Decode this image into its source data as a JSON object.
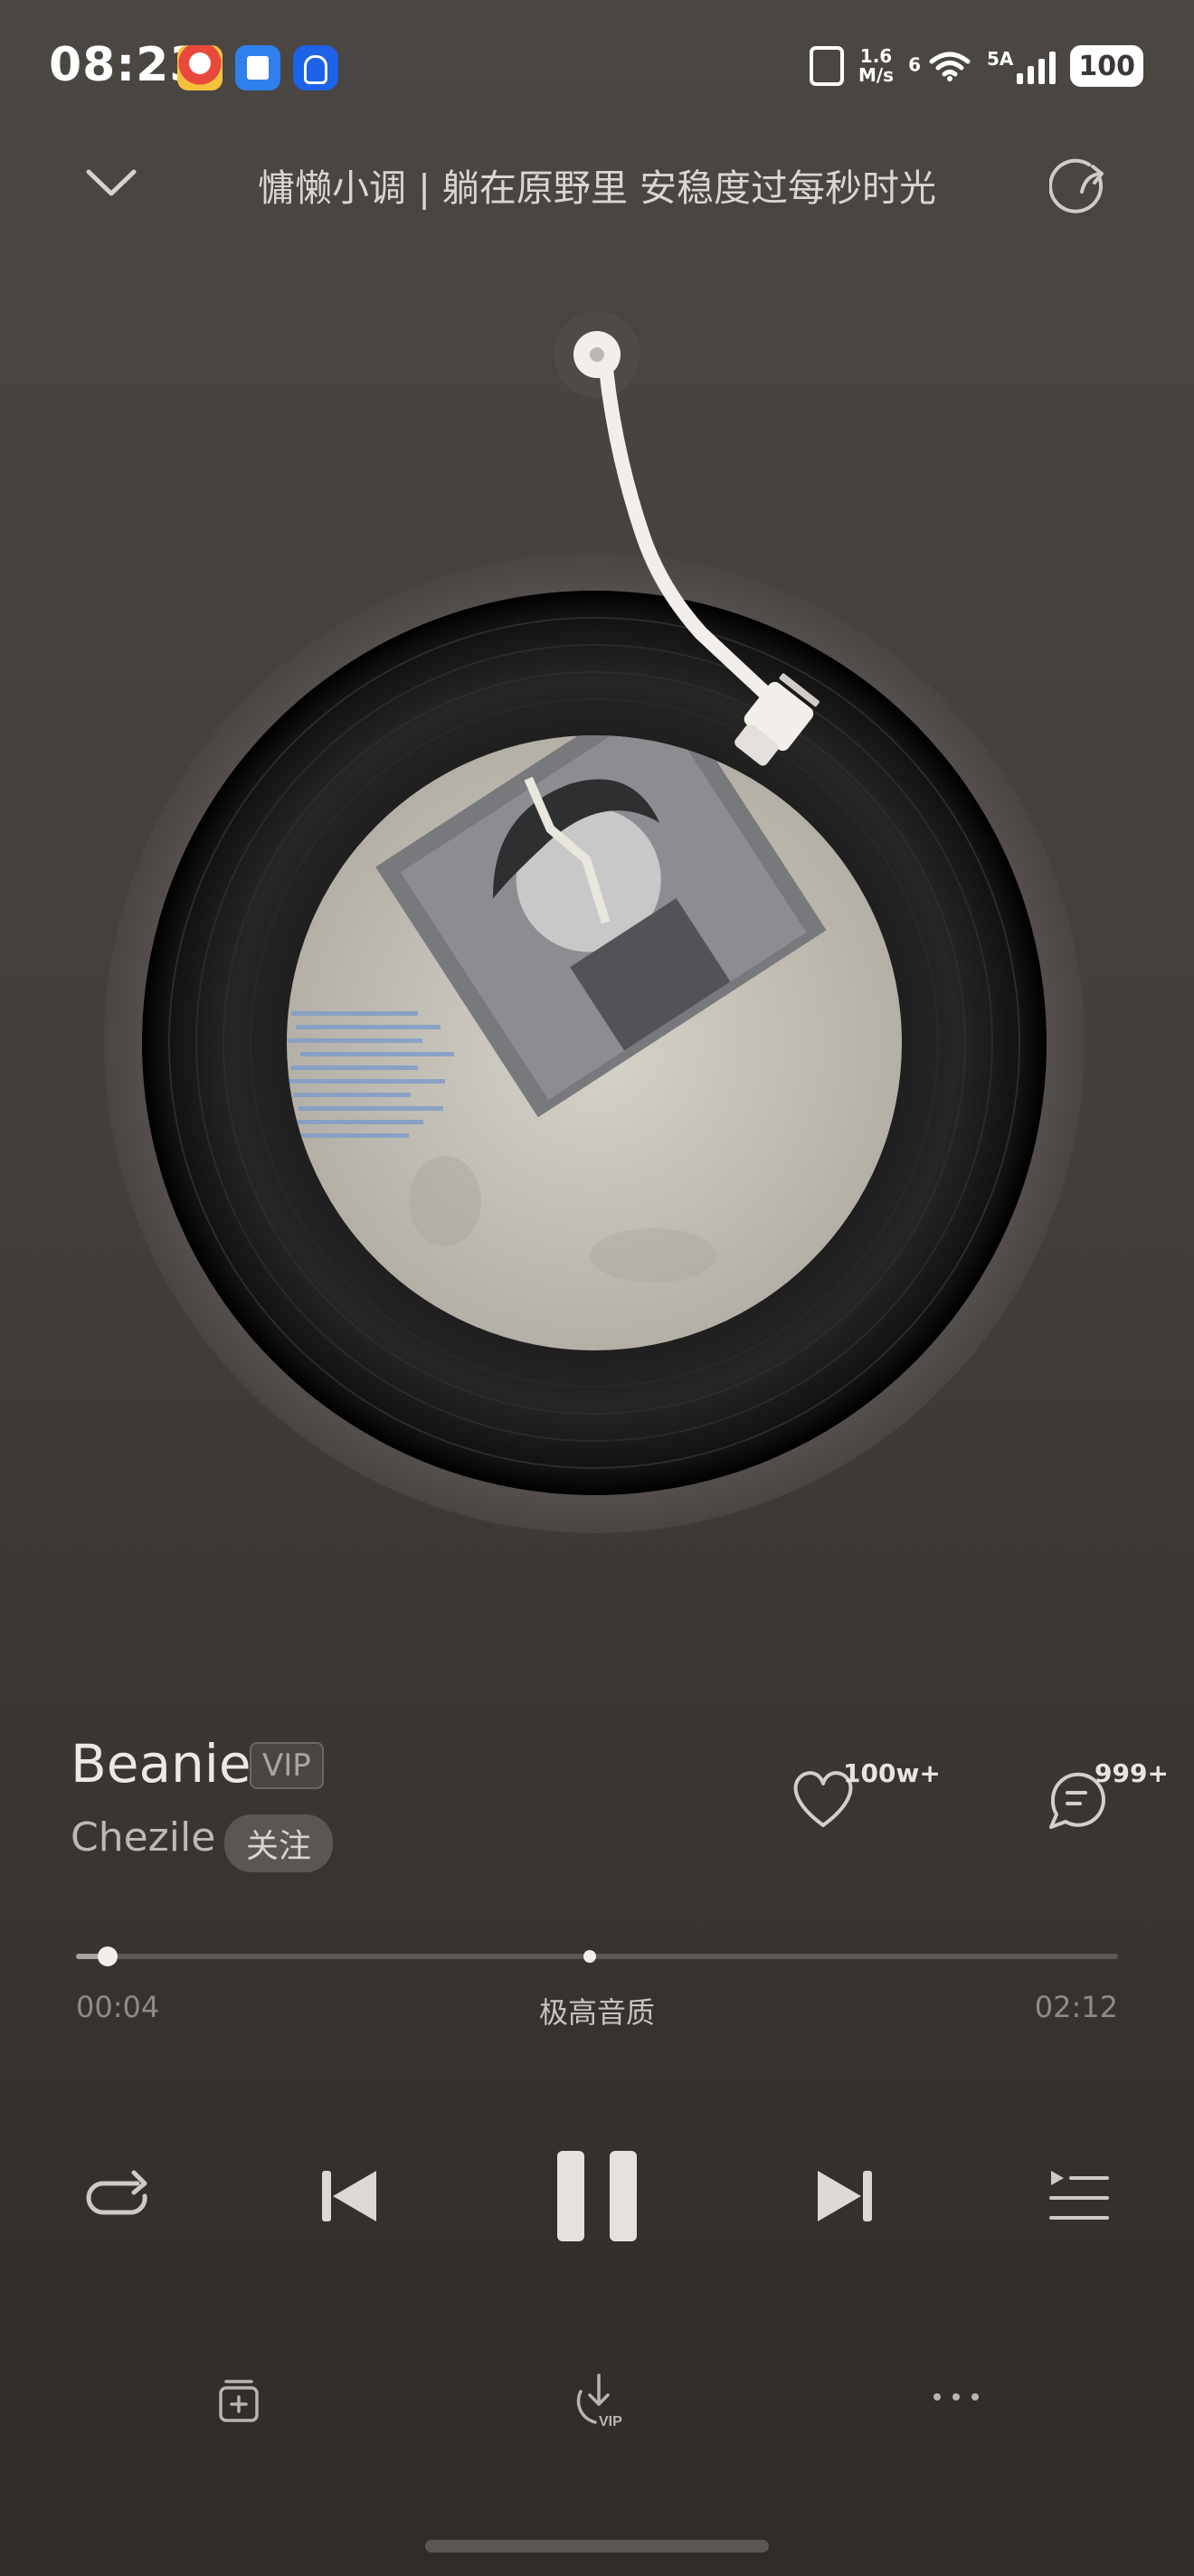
{
  "status_bar": {
    "time": "08:23",
    "net_speed_value": "1.6",
    "net_speed_unit": "M/s",
    "wifi_label": "6",
    "signal_label": "5A",
    "battery": "100"
  },
  "header": {
    "title": "慵懒小调 | 躺在原野里 安稳度过每秒时光"
  },
  "song": {
    "title": "Beanie",
    "vip_tag": "VIP",
    "artist": "Chezile",
    "follow_label": "关注",
    "likes": "100w+",
    "comments": "999+"
  },
  "progress": {
    "elapsed": "00:04",
    "total": "02:12",
    "fraction": 0.03,
    "quality": "极高音质"
  },
  "colors": {
    "accent": "#f2efeb",
    "background_top": "#4b4643",
    "background_bottom": "#2f2b28"
  },
  "icons": {
    "collapse": "chevron-down-icon",
    "share": "share-icon",
    "like": "heart-icon",
    "comment": "comment-icon",
    "repeat": "repeat-icon",
    "prev": "previous-icon",
    "pause": "pause-icon",
    "next": "next-icon",
    "playlist": "playlist-icon",
    "add": "add-to-playlist-icon",
    "download": "download-vip-icon",
    "more": "more-icon"
  }
}
